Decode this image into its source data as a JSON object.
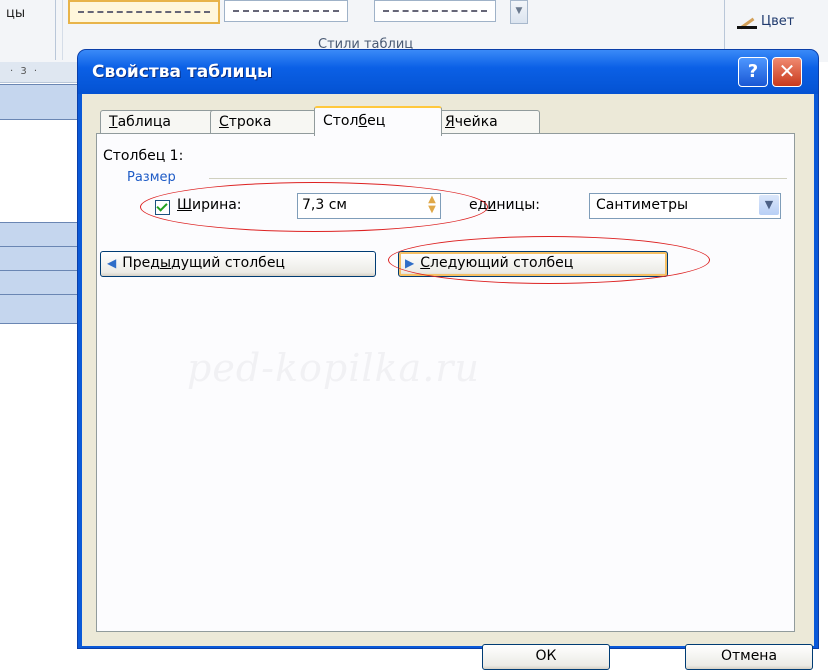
{
  "ribbon": {
    "left_label": "цы",
    "group_label": "Стили таблиц",
    "color_tool_label": "Цвет"
  },
  "ruler": {
    "marker": "· 3 ·"
  },
  "dialog": {
    "title": "Свойства таблицы",
    "help_label": "?",
    "close_label": "✕",
    "tabs": [
      {
        "label": "Таблица",
        "accel": "Т",
        "rest": "аблица"
      },
      {
        "label": "Строка",
        "accel": "С",
        "rest": "трока"
      },
      {
        "label": "Столбец",
        "before": "Стол",
        "accel": "б",
        "after": "ец"
      },
      {
        "label": "Ячейка",
        "accel": "Я",
        "rest": "чейка"
      }
    ],
    "selected_tab": "Столбец",
    "column_title": "Столбец 1:",
    "size_group": "Размер",
    "width_checkbox": {
      "checked": true,
      "accel": "Ш",
      "rest": "ирина:"
    },
    "width_value": "7,3 см",
    "units_label": {
      "before": "ед",
      "accel": "и",
      "after": "ницы:"
    },
    "units_value": "Сантиметры",
    "prev_button": {
      "before": "Пред",
      "accel": "ы",
      "after": "дущий столбец"
    },
    "next_button": {
      "accel": "С",
      "after": "ледующий столбец"
    },
    "ok_label": "ОК",
    "cancel_label": "Отмена",
    "watermark": "ped-kopilka.ru",
    "annotation_color": "#dd2222"
  }
}
